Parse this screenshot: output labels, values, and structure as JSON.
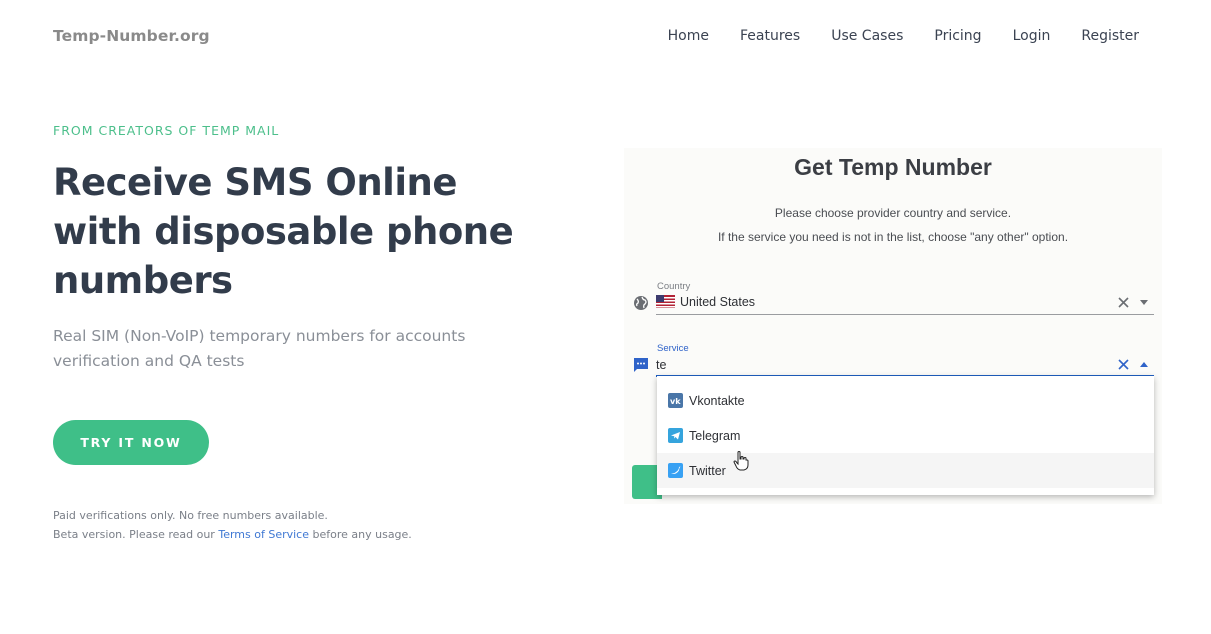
{
  "header": {
    "brand": "Temp-Number.org",
    "nav": [
      "Home",
      "Features",
      "Use Cases",
      "Pricing",
      "Login",
      "Register"
    ]
  },
  "hero": {
    "eyebrow": "FROM CREATORS OF TEMP MAIL",
    "headline_line1": "Receive SMS Online",
    "headline_line2": "with disposable phone",
    "headline_line3": "numbers",
    "subtitle_line1": "Real SIM (Non-VoIP) temporary numbers for accounts",
    "subtitle_line2": "verification and QA tests",
    "cta_label": "TRY IT NOW",
    "note_line1": "Paid verifications only. No free numbers available.",
    "note_line2_prefix": "Beta version. Please read our",
    "note_link": "Terms of Service",
    "note_line2_suffix": "before any usage."
  },
  "widget": {
    "title": "Get Temp Number",
    "desc_line1": "Please choose provider country and service.",
    "desc_line2": "If the service you need is not in the list, choose \"any other\" option.",
    "country": {
      "label": "Country",
      "value": "United States",
      "icon": "globe-icon",
      "flag": "us-flag-icon"
    },
    "service": {
      "label": "Service",
      "value": "te",
      "icon": "message-icon",
      "options": [
        {
          "label": "Vkontakte",
          "icon": "vk-icon"
        },
        {
          "label": "Telegram",
          "icon": "telegram-icon"
        },
        {
          "label": "Twitter",
          "icon": "twitter-icon"
        }
      ]
    }
  },
  "colors": {
    "accent": "#3fbf88",
    "heading": "#323c4b",
    "link": "#3f78d3",
    "active_underline": "#1f5fc2"
  }
}
